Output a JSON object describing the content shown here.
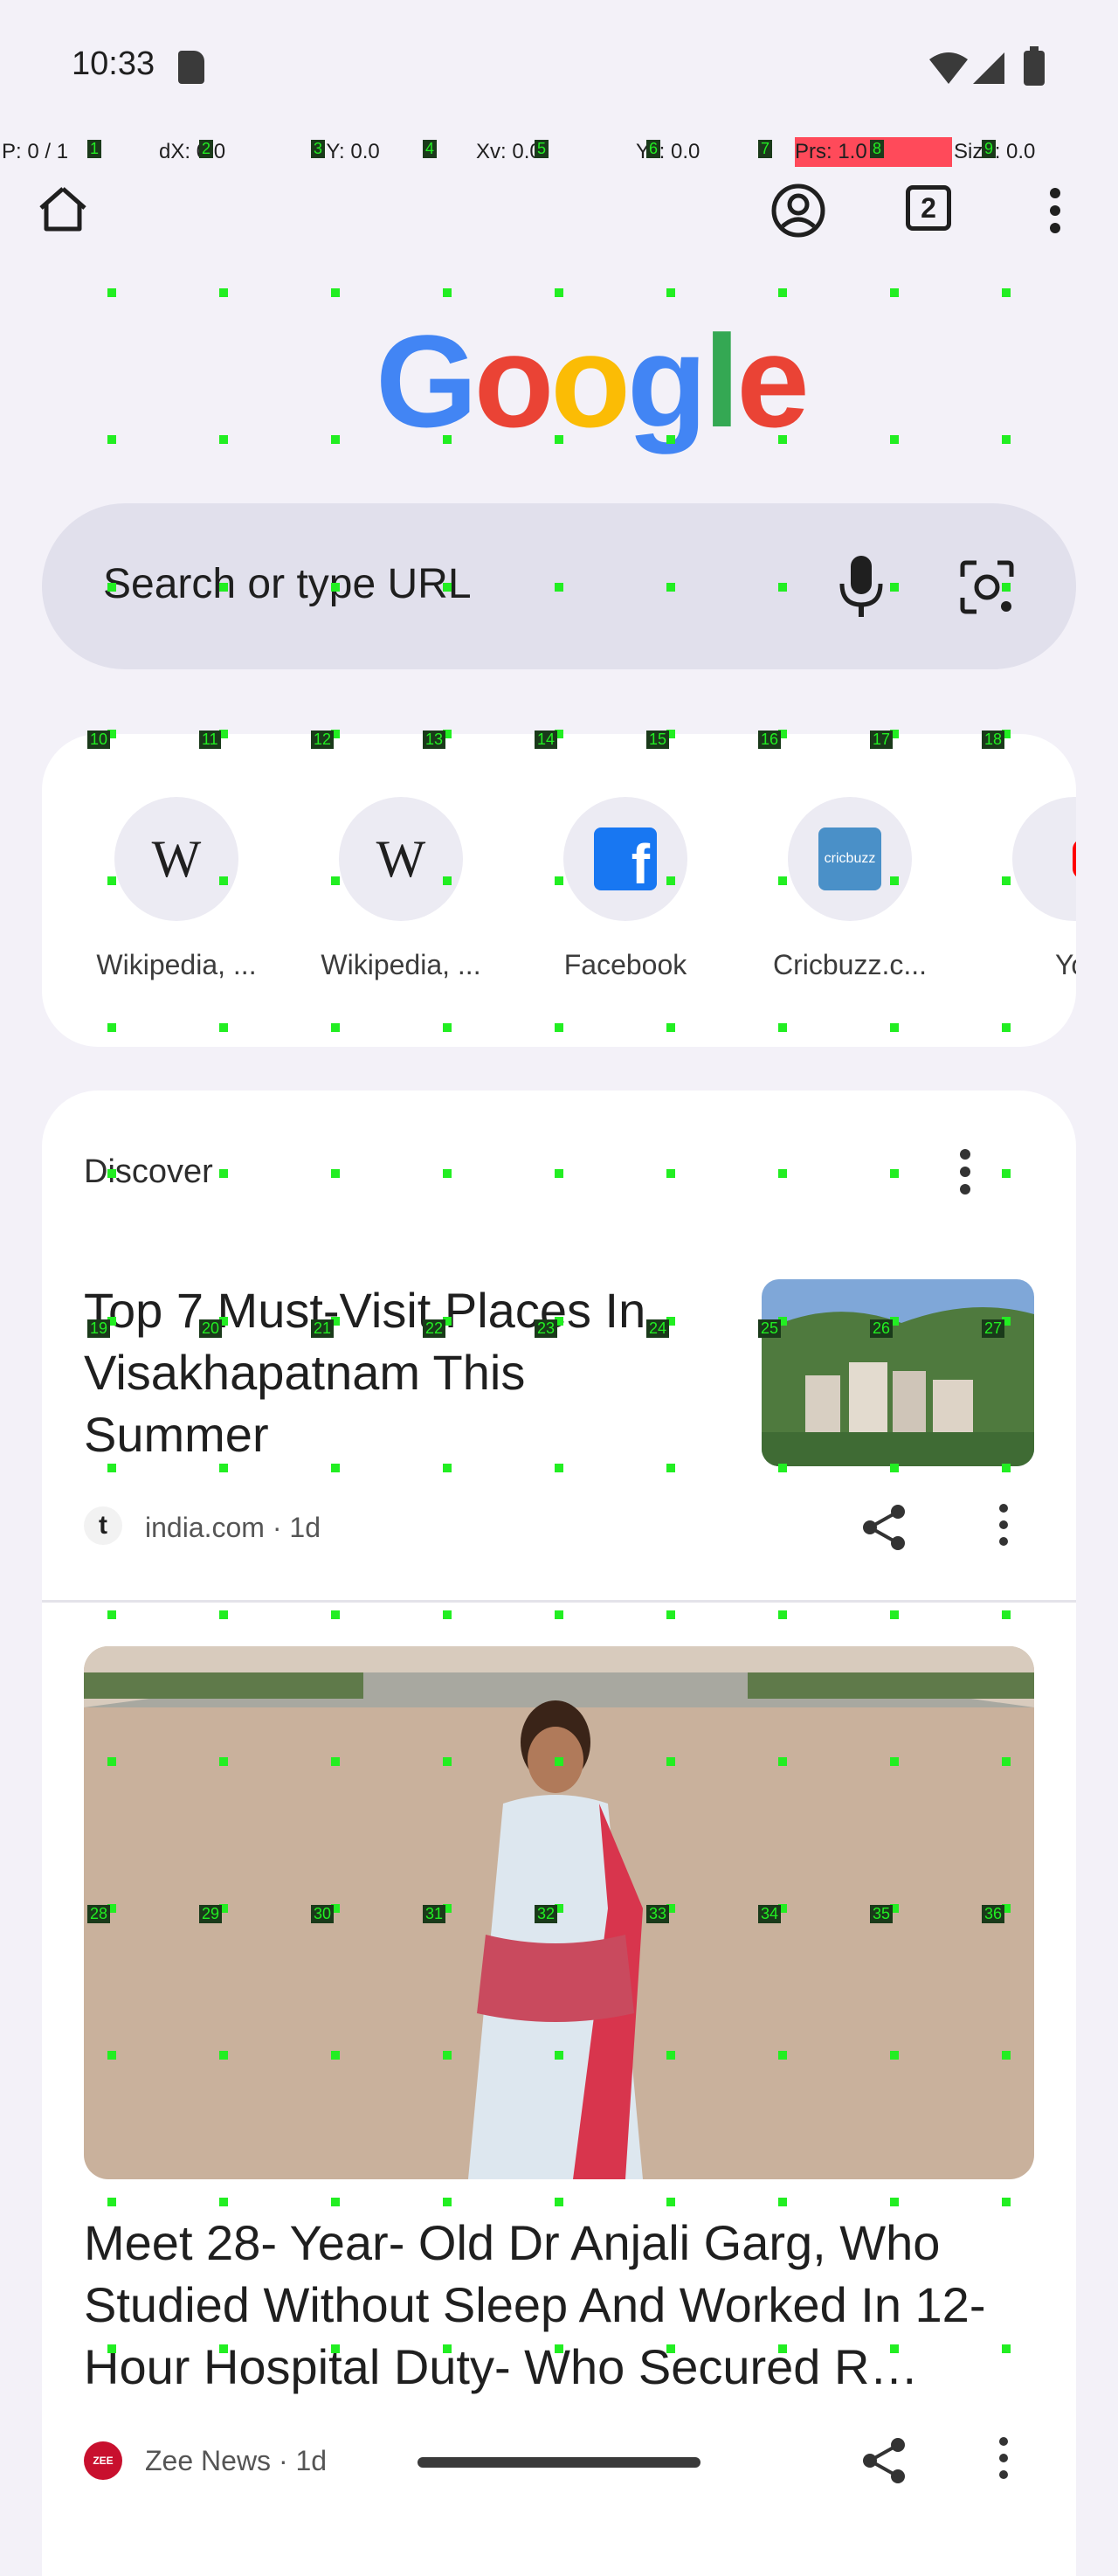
{
  "status_bar": {
    "time": "10:33"
  },
  "pointer_bar": {
    "p": "P: 0 / 1",
    "dx": "dX: 0.0",
    "dy": "dY: 0.0",
    "xv": "Xv: 0.0",
    "yv": "Yv: 0.0",
    "prs": "Prs: 1.0",
    "size": "Size: 0.0"
  },
  "toolbar": {
    "tab_count": "2"
  },
  "logo": {
    "text": "Google",
    "colors": [
      "#4285F4",
      "#EA4335",
      "#FBBC05",
      "#4285F4",
      "#34A853",
      "#EA4335"
    ]
  },
  "search": {
    "placeholder": "Search or type URL"
  },
  "shortcuts": [
    {
      "label": "Wikipedia, ...",
      "icon": "wikipedia-icon"
    },
    {
      "label": "Wikipedia, ...",
      "icon": "wikipedia-icon"
    },
    {
      "label": "Facebook",
      "icon": "facebook-icon"
    },
    {
      "label": "Cricbuzz.c...",
      "icon": "cricbuzz-icon"
    },
    {
      "label": "YouT",
      "icon": "youtube-icon"
    }
  ],
  "discover": {
    "title": "Discover",
    "articles": [
      {
        "title": "Top 7 Must-Visit Places In Visakhapatnam This Summer",
        "source": "india.com",
        "age": "1d"
      },
      {
        "title": "Meet 28- Year- Old Dr Anjali Garg, Who Studied Without Sleep And Worked In 12- Hour Hospital Duty- Who Secured R…",
        "source": "Zee News",
        "age": "1d"
      }
    ]
  },
  "overlay_numbers": [
    "1",
    "2",
    "3",
    "4",
    "5",
    "6",
    "7",
    "8",
    "9",
    "10",
    "11",
    "12",
    "13",
    "14",
    "15",
    "16",
    "17",
    "18",
    "19",
    "20",
    "21",
    "22",
    "23",
    "24",
    "25",
    "26",
    "27",
    "28",
    "29",
    "30",
    "31",
    "32",
    "33",
    "34",
    "35",
    "36"
  ]
}
